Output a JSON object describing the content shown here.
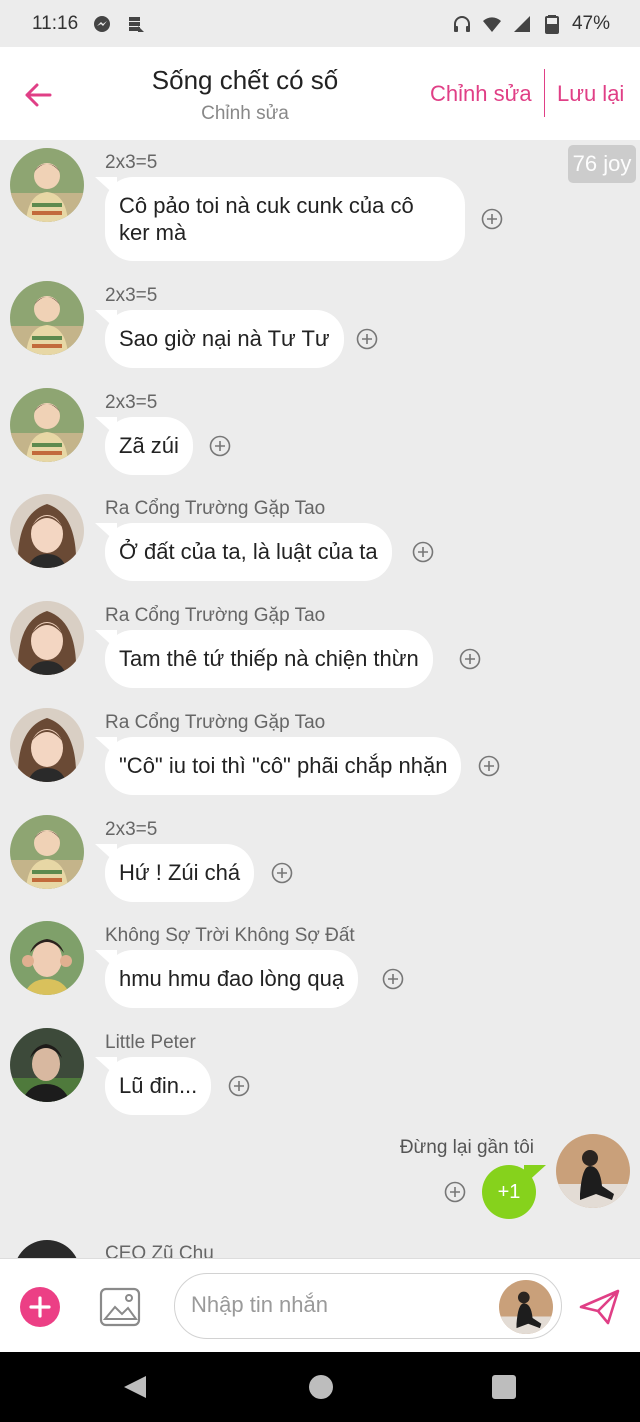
{
  "status_bar": {
    "time": "11:16",
    "battery": "47%"
  },
  "header": {
    "title": "Sống chết có số",
    "subtitle": "Chỉnh sửa",
    "edit_label": "Chỉnh sửa",
    "save_label": "Lưu lại"
  },
  "joy_badge": "76 joy",
  "messages": [
    {
      "sender": "2x3=5",
      "text_line1": "Cô pảo toi nà cuk cunk của cô",
      "text_line2": "ker mà",
      "text": "Sao giờ nại nà Tư Tư"
    },
    {
      "sender": "2x3=5",
      "text": "Sao giờ nại nà Tư Tư"
    },
    {
      "sender": "2x3=5",
      "text": "Zã zúi"
    },
    {
      "sender": "Ra Cổng Trường Gặp Tao",
      "text": "Ở đất của ta, là luật của ta"
    },
    {
      "sender": "Ra Cổng Trường Gặp Tao",
      "text": "Tam thê tứ thiếp nà chiện thừn"
    },
    {
      "sender": "Ra Cổng Trường Gặp Tao",
      "text": "\"Cô\" iu toi thì \"cô\" phãi chắp nhặn"
    },
    {
      "sender": "2x3=5",
      "text": "Hứ ! Zúi chá"
    },
    {
      "sender": "Không Sợ Trời Không Sợ Đất",
      "text": "hmu hmu đao lòng quạ"
    },
    {
      "sender": "Little Peter",
      "text": "Lũ đin..."
    }
  ],
  "own_message": {
    "sender": "Đừng lại gần tôi",
    "text": "+1"
  },
  "partial_sender": "CEO Zũ Chu",
  "composer": {
    "placeholder": "Nhập tin nhắn"
  },
  "colors": {
    "accent": "#e03f86",
    "own_bubble": "#86d21c",
    "background": "#ececec"
  },
  "icons": [
    "back-arrow-icon",
    "plus-circle-icon",
    "image-icon",
    "send-icon",
    "add-icon"
  ]
}
